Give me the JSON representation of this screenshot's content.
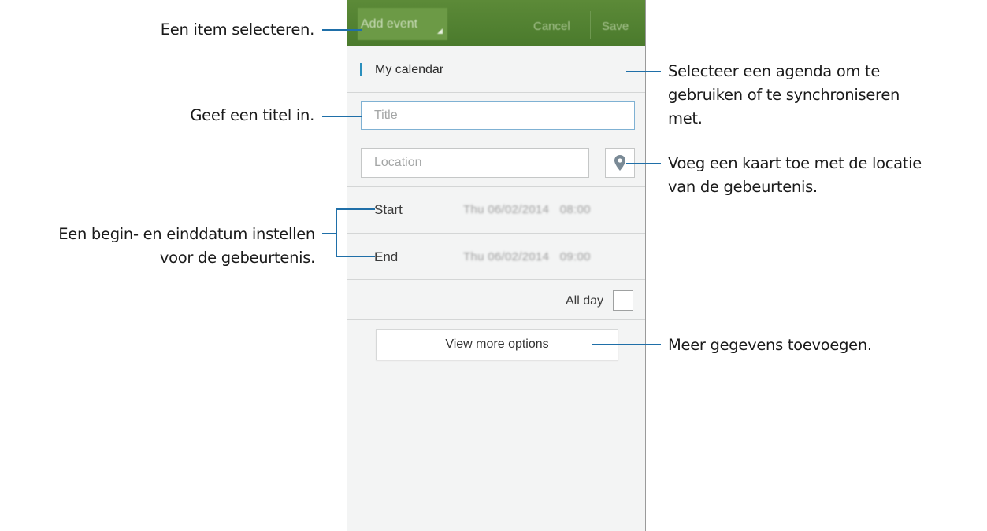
{
  "actionbar": {
    "event_type": "Add event",
    "cancel": "Cancel",
    "save": "Save"
  },
  "calendar": {
    "label": "My calendar"
  },
  "form": {
    "title_placeholder": "Title",
    "location_placeholder": "Location",
    "start_label": "Start",
    "start_value": "Thu 06/02/2014   08:00",
    "end_label": "End",
    "end_value": "Thu 06/02/2014   09:00",
    "allday_label": "All day",
    "allday_checked": false,
    "more_options": "View more options"
  },
  "icons": {
    "map": "map-pin-icon",
    "dropdown": "dropdown-corner-icon"
  },
  "colors": {
    "actionbar": "#4f7f30",
    "accent": "#2a8fbd",
    "callout_line": "#1f6fa8"
  },
  "callouts": {
    "select_item": "Een item selecteren.",
    "enter_title": "Geef een titel in.",
    "date_line1": "Een begin- en einddatum instellen",
    "date_line2": "voor de gebeurtenis.",
    "calendar_line1": "Selecteer een agenda om te",
    "calendar_line2": "gebruiken of te synchroniseren",
    "calendar_line3": "met.",
    "map_line1": "Voeg een kaart toe met de locatie",
    "map_line2": "van de gebeurtenis.",
    "more": "Meer gegevens toevoegen."
  }
}
